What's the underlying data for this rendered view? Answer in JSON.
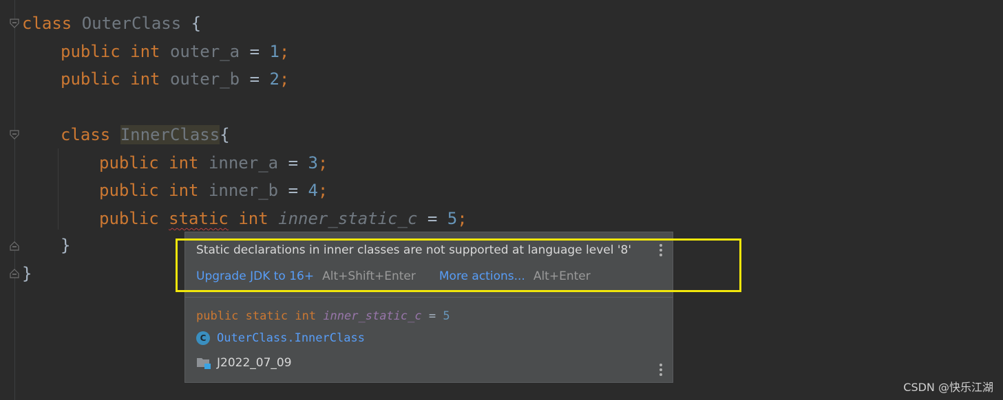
{
  "editor": {
    "lines": [
      {
        "kw": "class",
        "name": "OuterClass",
        "rest": " {"
      },
      {
        "kw": "public int",
        "name": "outer_a",
        "num": "1"
      },
      {
        "kw": "public int",
        "name": "outer_b",
        "num": "2"
      },
      {
        "kw": "class",
        "name": "InnerClass",
        "rest": "{"
      },
      {
        "kw": "public int",
        "name": "inner_a",
        "num": "3"
      },
      {
        "kw": "public int",
        "name": "inner_b",
        "num": "4"
      },
      {
        "kw1": "public",
        "kw2": "static",
        "kw3": "int",
        "name": "inner_static_c",
        "num": "5"
      },
      {
        "rest": "}"
      },
      {
        "rest": "}"
      }
    ],
    "equals": "=",
    "semicolon": ";",
    "error_underline_color": "#bc3f3c",
    "highlight_color": "#4e4b36"
  },
  "popup": {
    "message": "Static declarations in inner classes are not supported at language level '8'",
    "fix_label": "Upgrade JDK to 16+",
    "fix_shortcut": "Alt+Shift+Enter",
    "more_label": "More actions...",
    "more_shortcut": "Alt+Enter",
    "doc_public": "public",
    "doc_static": "static",
    "doc_int": "int",
    "doc_name": "inner_static_c",
    "doc_equals": "=",
    "doc_value": "5",
    "class_icon_letter": "C",
    "class_path": "OuterClass.InnerClass",
    "module_name": "J2022_07_09"
  },
  "annotation": {
    "highlight_color": "#f2e70b"
  },
  "watermark": "CSDN @快乐江湖"
}
